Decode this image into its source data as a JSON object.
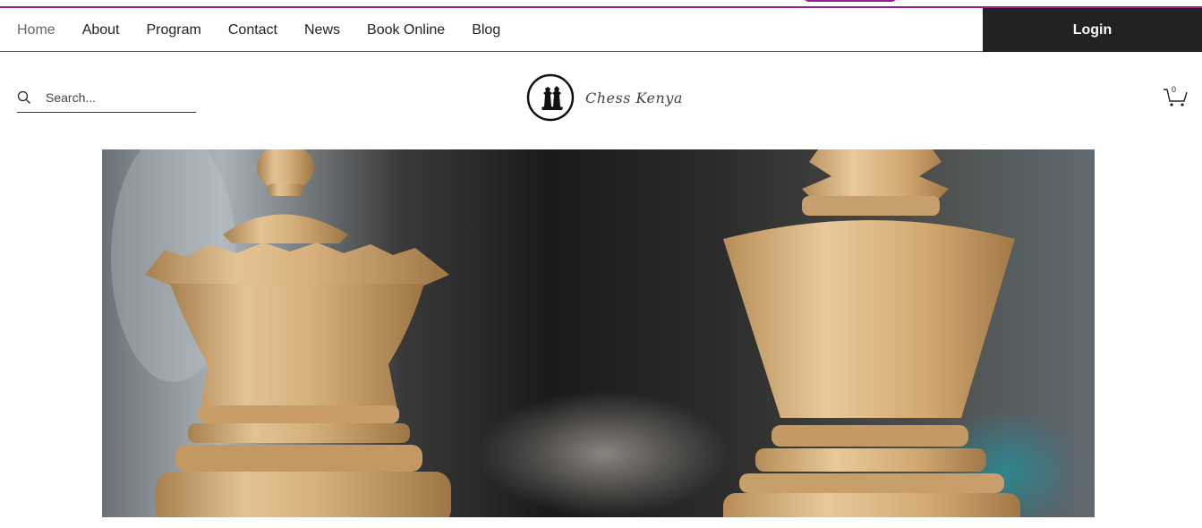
{
  "nav": {
    "items": [
      {
        "label": "Home"
      },
      {
        "label": "About"
      },
      {
        "label": "Program"
      },
      {
        "label": "Contact"
      },
      {
        "label": "News"
      },
      {
        "label": "Book Online"
      },
      {
        "label": "Blog"
      }
    ],
    "active_index": 0
  },
  "login": {
    "label": "Login"
  },
  "search": {
    "placeholder": "Search..."
  },
  "logo": {
    "text": "Chess Kenya",
    "icon": "chess-pieces-logo-icon"
  },
  "cart": {
    "count": "0",
    "icon": "cart-icon"
  },
  "hero": {
    "alt": "Wooden chess queen and king"
  },
  "colors": {
    "accent": "#9b1f8a",
    "login_bg": "#222222",
    "wood": "#d9b583"
  }
}
